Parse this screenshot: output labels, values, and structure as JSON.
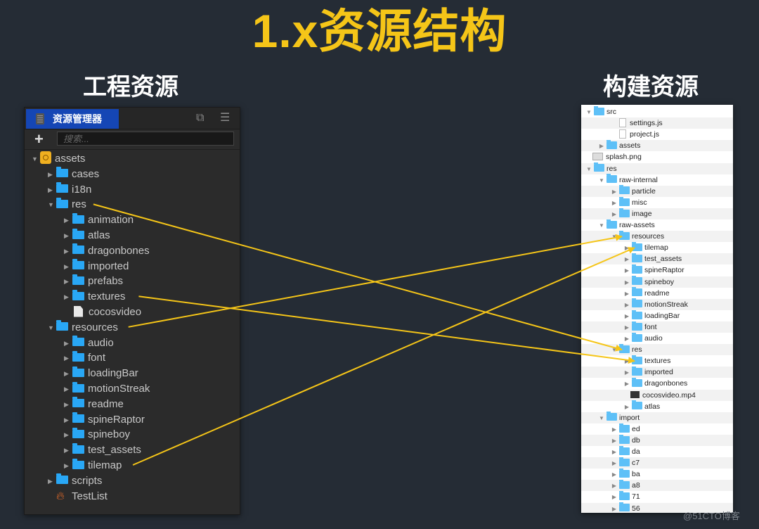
{
  "title": "1.x资源结构",
  "left_heading": "工程资源",
  "right_heading": "构建资源",
  "colors": {
    "title": "#f5c518",
    "arrow": "#f5c518",
    "tab_active": "#1546b5",
    "folder_dark": "#29a7f5",
    "folder_light": "#5ec0f7",
    "background": "#252c35"
  },
  "editor_panel": {
    "tab_label": "资源管理器",
    "add_label": "+",
    "search_placeholder": "搜索...",
    "popout_icon": "popout-icon",
    "menu_icon": "menu-icon",
    "tree": [
      {
        "label": "assets",
        "depth": 0,
        "icon": "db",
        "expanded": true
      },
      {
        "label": "cases",
        "depth": 1,
        "icon": "folder",
        "expanded": false
      },
      {
        "label": "i18n",
        "depth": 1,
        "icon": "folder",
        "expanded": false
      },
      {
        "label": "res",
        "depth": 1,
        "icon": "folder",
        "expanded": true
      },
      {
        "label": "animation",
        "depth": 2,
        "icon": "folder",
        "expanded": false
      },
      {
        "label": "atlas",
        "depth": 2,
        "icon": "folder",
        "expanded": false
      },
      {
        "label": "dragonbones",
        "depth": 2,
        "icon": "folder",
        "expanded": false
      },
      {
        "label": "imported",
        "depth": 2,
        "icon": "folder",
        "expanded": false
      },
      {
        "label": "prefabs",
        "depth": 2,
        "icon": "folder",
        "expanded": false
      },
      {
        "label": "textures",
        "depth": 2,
        "icon": "folder",
        "expanded": false
      },
      {
        "label": "cocosvideo",
        "depth": 2,
        "icon": "file",
        "expanded": null
      },
      {
        "label": "resources",
        "depth": 1,
        "icon": "folder",
        "expanded": true
      },
      {
        "label": "audio",
        "depth": 2,
        "icon": "folder",
        "expanded": false
      },
      {
        "label": "font",
        "depth": 2,
        "icon": "folder",
        "expanded": false
      },
      {
        "label": "loadingBar",
        "depth": 2,
        "icon": "folder",
        "expanded": false
      },
      {
        "label": "motionStreak",
        "depth": 2,
        "icon": "folder",
        "expanded": false
      },
      {
        "label": "readme",
        "depth": 2,
        "icon": "folder",
        "expanded": false
      },
      {
        "label": "spineRaptor",
        "depth": 2,
        "icon": "folder",
        "expanded": false
      },
      {
        "label": "spineboy",
        "depth": 2,
        "icon": "folder",
        "expanded": false
      },
      {
        "label": "test_assets",
        "depth": 2,
        "icon": "folder",
        "expanded": false
      },
      {
        "label": "tilemap",
        "depth": 2,
        "icon": "folder",
        "expanded": false
      },
      {
        "label": "scripts",
        "depth": 1,
        "icon": "folder",
        "expanded": false
      },
      {
        "label": "TestList",
        "depth": 1,
        "icon": "fire",
        "expanded": null
      }
    ]
  },
  "build_panel": {
    "tree": [
      {
        "label": "src",
        "depth": 0,
        "icon": "folder",
        "expanded": true
      },
      {
        "label": "settings.js",
        "depth": 2,
        "icon": "doc",
        "expanded": null
      },
      {
        "label": "project.js",
        "depth": 2,
        "icon": "doc",
        "expanded": null
      },
      {
        "label": "assets",
        "depth": 1,
        "icon": "folder",
        "expanded": false
      },
      {
        "label": "splash.png",
        "depth": 0,
        "icon": "img",
        "expanded": null
      },
      {
        "label": "res",
        "depth": 0,
        "icon": "folder",
        "expanded": true
      },
      {
        "label": "raw-internal",
        "depth": 1,
        "icon": "folder",
        "expanded": true
      },
      {
        "label": "particle",
        "depth": 2,
        "icon": "folder",
        "expanded": false
      },
      {
        "label": "misc",
        "depth": 2,
        "icon": "folder",
        "expanded": false
      },
      {
        "label": "image",
        "depth": 2,
        "icon": "folder",
        "expanded": false
      },
      {
        "label": "raw-assets",
        "depth": 1,
        "icon": "folder",
        "expanded": true
      },
      {
        "label": "resources",
        "depth": 2,
        "icon": "folder",
        "expanded": true
      },
      {
        "label": "tilemap",
        "depth": 3,
        "icon": "folder",
        "expanded": false
      },
      {
        "label": "test_assets",
        "depth": 3,
        "icon": "folder",
        "expanded": false
      },
      {
        "label": "spineRaptor",
        "depth": 3,
        "icon": "folder",
        "expanded": false
      },
      {
        "label": "spineboy",
        "depth": 3,
        "icon": "folder",
        "expanded": false
      },
      {
        "label": "readme",
        "depth": 3,
        "icon": "folder",
        "expanded": false
      },
      {
        "label": "motionStreak",
        "depth": 3,
        "icon": "folder",
        "expanded": false
      },
      {
        "label": "loadingBar",
        "depth": 3,
        "icon": "folder",
        "expanded": false
      },
      {
        "label": "font",
        "depth": 3,
        "icon": "folder",
        "expanded": false
      },
      {
        "label": "audio",
        "depth": 3,
        "icon": "folder",
        "expanded": false
      },
      {
        "label": "res",
        "depth": 2,
        "icon": "folder",
        "expanded": true
      },
      {
        "label": "textures",
        "depth": 3,
        "icon": "folder",
        "expanded": false
      },
      {
        "label": "imported",
        "depth": 3,
        "icon": "folder",
        "expanded": false
      },
      {
        "label": "dragonbones",
        "depth": 3,
        "icon": "folder",
        "expanded": false
      },
      {
        "label": "cocosvideo.mp4",
        "depth": 3,
        "icon": "video",
        "expanded": null
      },
      {
        "label": "atlas",
        "depth": 3,
        "icon": "folder",
        "expanded": false
      },
      {
        "label": "import",
        "depth": 1,
        "icon": "folder",
        "expanded": true
      },
      {
        "label": "ed",
        "depth": 2,
        "icon": "folder",
        "expanded": false
      },
      {
        "label": "db",
        "depth": 2,
        "icon": "folder",
        "expanded": false
      },
      {
        "label": "da",
        "depth": 2,
        "icon": "folder",
        "expanded": false
      },
      {
        "label": "c7",
        "depth": 2,
        "icon": "folder",
        "expanded": false
      },
      {
        "label": "ba",
        "depth": 2,
        "icon": "folder",
        "expanded": false
      },
      {
        "label": "a8",
        "depth": 2,
        "icon": "folder",
        "expanded": false
      },
      {
        "label": "71",
        "depth": 2,
        "icon": "folder",
        "expanded": false
      },
      {
        "label": "56",
        "depth": 2,
        "icon": "folder",
        "expanded": false
      }
    ]
  },
  "mappings": [
    {
      "from": "res",
      "to": "raw-assets/res"
    },
    {
      "from": "textures",
      "to": "raw-assets/res/textures"
    },
    {
      "from": "resources",
      "to": "raw-assets/resources"
    },
    {
      "from": "tilemap",
      "to": "raw-assets/resources/tilemap"
    }
  ],
  "watermark": "@51CTO博客"
}
